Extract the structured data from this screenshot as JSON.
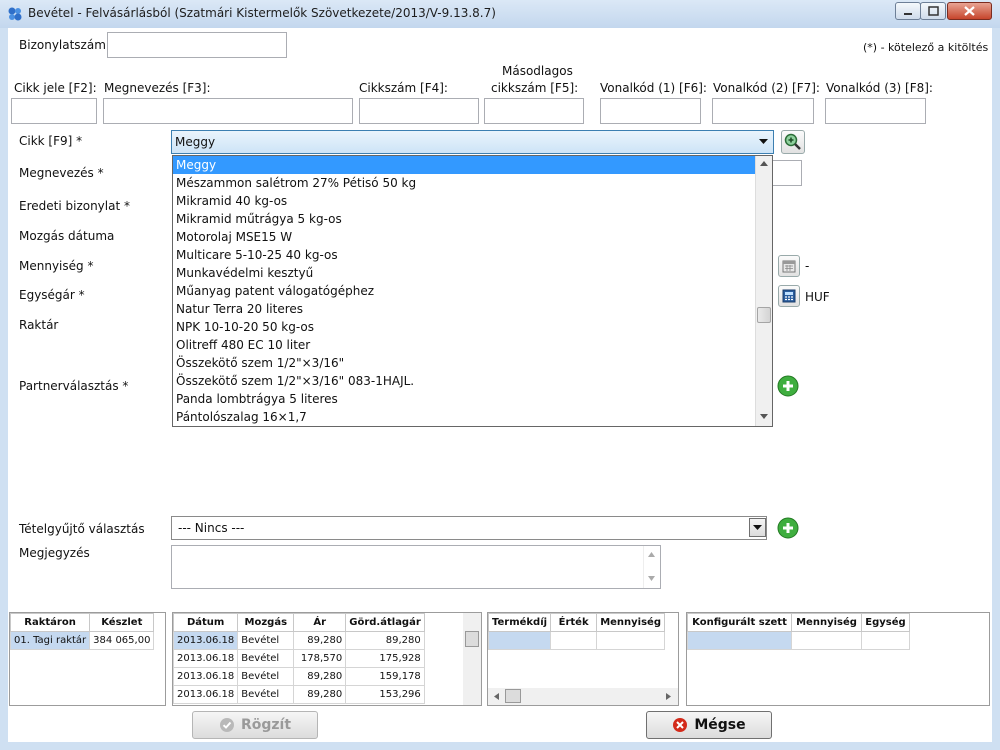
{
  "window": {
    "title": "Bevétel - Felvásárlásból (Szatmári Kistermelők Szövetkezete/2013/V-9.13.8.7)"
  },
  "header": {
    "doc_number_label": "Bizonylatszám",
    "required_note": "(*) - kötelező a kitöltés"
  },
  "search": {
    "code_label": "Cikk jele [F2]:",
    "name_label": "Megnevezés [F3]:",
    "item_number_label": "Cikkszám [F4]:",
    "secondary_label_line1": "Másodlagos",
    "secondary_label_line2": "cikkszám [F5]:",
    "barcode1_label": "Vonalkód (1) [F6]:",
    "barcode2_label": "Vonalkód (2) [F7]:",
    "barcode3_label": "Vonalkód (3) [F8]:"
  },
  "form": {
    "item_label": "Cikk [F9] *",
    "item_value": "Meggy",
    "name_label": "Megnevezés *",
    "orig_doc_label": "Eredeti bizonylat *",
    "move_date_label": "Mozgás dátuma",
    "quantity_label": "Mennyiség *",
    "unit_price_label": "Egységár *",
    "currency": "HUF",
    "dash": "-",
    "warehouse_label": "Raktár",
    "partner_label": "Partnerválasztás *",
    "collector_label": "Tételgyűjtő választás",
    "collector_value": "--- Nincs ---",
    "note_label": "Megjegyzés"
  },
  "dropdown_items": [
    "Meggy",
    "Mészammon salétrom 27% Pétisó 50 kg",
    "Mikramid  40 kg-os",
    "Mikramid műtrágya 5 kg-os",
    "Motorolaj MSE15 W",
    "Multicare 5-10-25  40 kg-os",
    "Munkavédelmi kesztyű",
    "Műanyag patent válogatógéphez",
    "Natur Terra 20 literes",
    "NPK 10-10-20  50 kg-os",
    "Olitreff 480 EC  10 liter",
    "Összekötő szem 1/2\"×3/16\"",
    "Összekötő szem 1/2\"×3/16\" 083-1HAJL.",
    "Panda lombtrágya 5 literes",
    "Pántolószalag 16×1,7"
  ],
  "stock_grid": {
    "headers": [
      "Raktáron",
      "Készlet"
    ],
    "rows": [
      [
        "01. Tagi raktár",
        "384 065,00"
      ]
    ]
  },
  "history_grid": {
    "headers": [
      "Dátum",
      "Mozgás",
      "Ár",
      "Görd.átlagár"
    ],
    "rows": [
      [
        "2013.06.18",
        "Bevétel",
        "89,280",
        "89,280"
      ],
      [
        "2013.06.18",
        "Bevétel",
        "178,570",
        "175,928"
      ],
      [
        "2013.06.18",
        "Bevétel",
        "89,280",
        "159,178"
      ],
      [
        "2013.06.18",
        "Bevétel",
        "89,280",
        "153,296"
      ]
    ]
  },
  "fee_grid": {
    "headers": [
      "Termékdíj",
      "Érték",
      "Mennyiség"
    ]
  },
  "config_grid": {
    "headers": [
      "Konfigurált szett",
      "Mennyiség",
      "Egység"
    ]
  },
  "buttons": {
    "save": "Rögzít",
    "cancel": "Mégse"
  }
}
